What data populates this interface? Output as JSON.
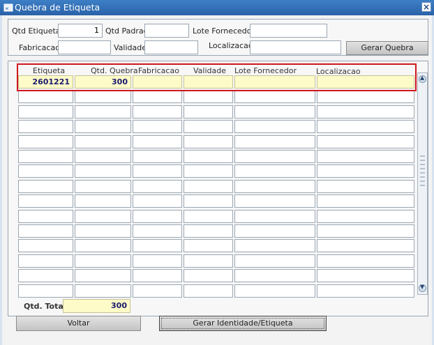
{
  "window": {
    "title": "Quebra de Etiqueta"
  },
  "filters": {
    "qtd_etiquetas_label": "Qtd Etiquetas",
    "qtd_etiquetas_value": "1",
    "qtd_padrao_label": "Qtd Padrao",
    "qtd_padrao_value": "",
    "lote_fornecedor_label": "Lote Fornecedor",
    "lote_fornecedor_value": "",
    "fabricacao_label": "Fabricacao",
    "fabricacao_value": "",
    "validade_label": "Validade",
    "validade_value": "",
    "localizacao_label": "Localizacao",
    "localizacao_value": "",
    "gerar_quebra_label": "Gerar Quebra"
  },
  "grid": {
    "headers": [
      "Etiqueta",
      "Qtd. Quebra",
      "Fabricacao",
      "Validade",
      "Lote Fornecedor",
      "Localizacao"
    ],
    "rows": [
      [
        "2601221",
        "300",
        "",
        "",
        "",
        ""
      ]
    ],
    "empty_row_count": 14
  },
  "footer": {
    "qtd_total_label": "Qtd. Total",
    "qtd_total_value": "300",
    "voltar_label": "Voltar",
    "gerar_identidade_label": "Gerar Identidade/Etiqueta"
  },
  "colors": {
    "title_bar": "#2f6db5",
    "highlight_row": "#fdfbc7",
    "selection_box": "#d0161c"
  },
  "icons": {
    "app": "oracle-forms-icon",
    "close": "close-icon"
  }
}
